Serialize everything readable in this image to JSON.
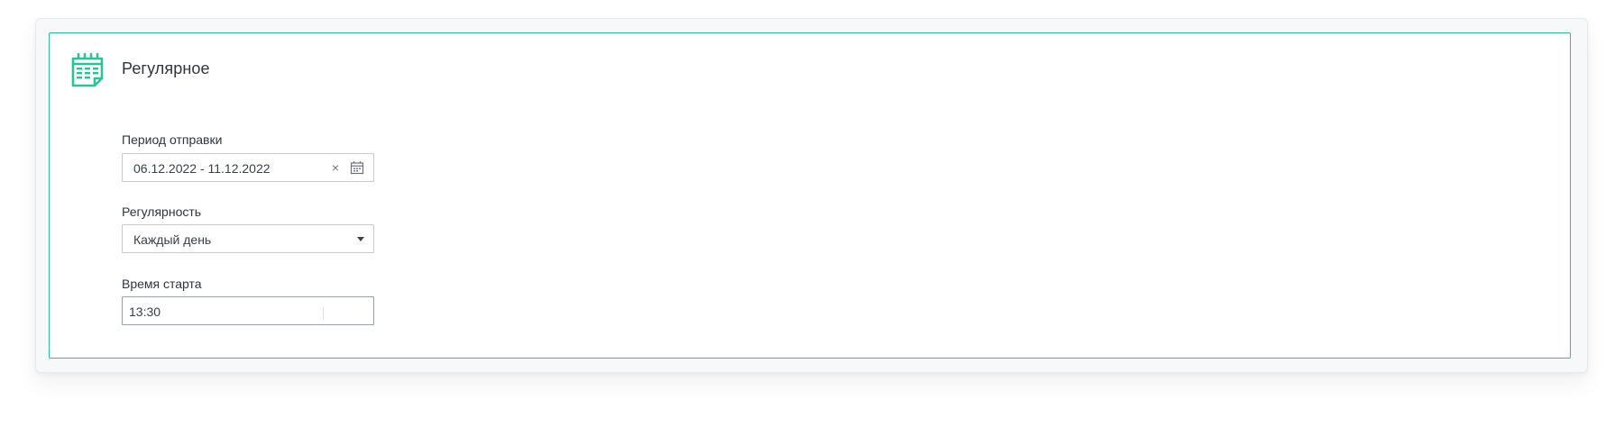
{
  "section": {
    "title": "Регулярное",
    "icon": "calendar-icon",
    "accent_color": "#2cc197"
  },
  "period": {
    "label": "Период отправки",
    "value": "06.12.2022 - 11.12.2022",
    "clear_symbol": "×",
    "calendar_icon": "calendar-small-icon"
  },
  "regularity": {
    "label": "Регулярность",
    "value": "Каждый день",
    "dropdown_icon": "caret-down-icon"
  },
  "start_time": {
    "label": "Время старта",
    "value": "13:30"
  }
}
